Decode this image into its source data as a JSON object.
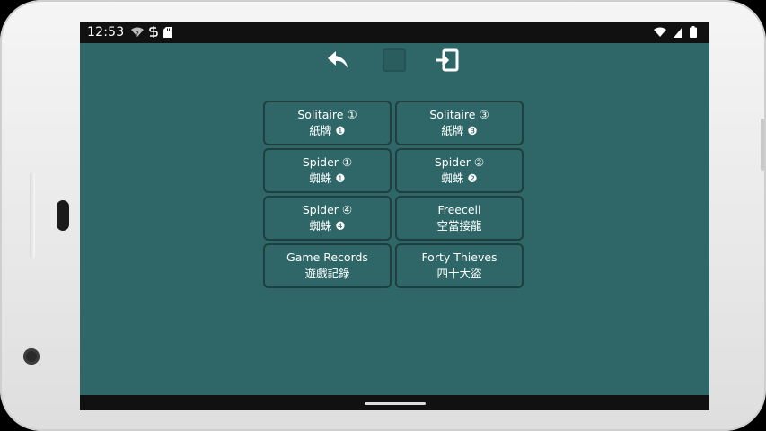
{
  "status": {
    "time": "12:53"
  },
  "toolbar": {
    "undo_icon": "undo-arrow",
    "middle_icon": "square",
    "exit_icon": "exit-door"
  },
  "menu": {
    "items": [
      {
        "title": "Solitaire ①",
        "subtitle": "紙牌 ❶"
      },
      {
        "title": "Solitaire ③",
        "subtitle": "紙牌 ❸"
      },
      {
        "title": "Spider ①",
        "subtitle": "蜘蛛 ❶"
      },
      {
        "title": "Spider ②",
        "subtitle": "蜘蛛 ❷"
      },
      {
        "title": "Spider ④",
        "subtitle": "蜘蛛 ❹"
      },
      {
        "title": "Freecell",
        "subtitle": "空當接龍"
      },
      {
        "title": "Game Records",
        "subtitle": "遊戲記錄"
      },
      {
        "title": "Forty Thieves",
        "subtitle": "四十大盜"
      }
    ]
  },
  "colors": {
    "background": "#2f6768",
    "card_border": "#1f3e3e",
    "text": "#ffffff",
    "status_bar": "#111111"
  }
}
